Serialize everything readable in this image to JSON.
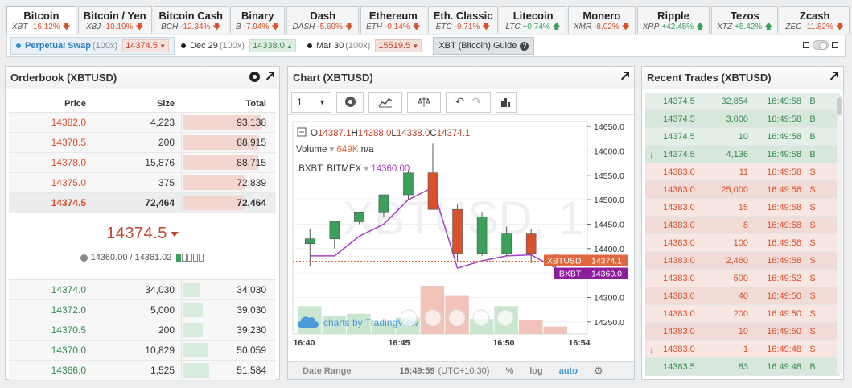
{
  "tabs": [
    {
      "name": "Bitcoin",
      "sym": "XBT",
      "change": "-16.12%",
      "dir": "neg",
      "active": true
    },
    {
      "name": "Bitcoin / Yen",
      "sym": "XBJ",
      "change": "-10.19%",
      "dir": "neg"
    },
    {
      "name": "Bitcoin Cash",
      "sym": "BCH",
      "change": "-12.34%",
      "dir": "neg"
    },
    {
      "name": "Binary",
      "sym": "B",
      "change": "-7.94%",
      "dir": "neg"
    },
    {
      "name": "Dash",
      "sym": "DASH",
      "change": "-5.69%",
      "dir": "neg"
    },
    {
      "name": "Ethereum",
      "sym": "ETH",
      "change": "-0.14%",
      "dir": "neg"
    },
    {
      "name": "Eth. Classic",
      "sym": "ETC",
      "change": "-9.71%",
      "dir": "neg"
    },
    {
      "name": "Litecoin",
      "sym": "LTC",
      "change": "+0.74%",
      "dir": "pos"
    },
    {
      "name": "Monero",
      "sym": "XMR",
      "change": "-8.02%",
      "dir": "neg"
    },
    {
      "name": "Ripple",
      "sym": "XRP",
      "change": "+42.45%",
      "dir": "pos"
    },
    {
      "name": "Tezos",
      "sym": "XTZ",
      "change": "+5.42%",
      "dir": "pos"
    },
    {
      "name": "Zcash",
      "sym": "ZEC",
      "change": "-11.82%",
      "dir": "neg"
    }
  ],
  "contracts": [
    {
      "label": "Perpetual Swap",
      "mult": "(100x)",
      "price": "14374.5",
      "dir": "neg",
      "active": true
    },
    {
      "label": "Dec 29",
      "mult": "(100x)",
      "price": "14338.0",
      "dir": "pos"
    },
    {
      "label": "Mar 30",
      "mult": "(100x)",
      "price": "15519.5",
      "dir": "neg"
    }
  ],
  "guide_label": "XBT (Bitcoin) Guide",
  "guide_icon": "?",
  "orderbook": {
    "title": "Orderbook (XBTUSD)",
    "col_price": "Price",
    "col_size": "Size",
    "col_total": "Total",
    "asks": [
      {
        "price": "14382.0",
        "size": "4,223",
        "total": "93,138",
        "depth": 0.93
      },
      {
        "price": "14378.5",
        "size": "200",
        "total": "88,915",
        "depth": 0.89
      },
      {
        "price": "14378.0",
        "size": "15,876",
        "total": "88,715",
        "depth": 0.89
      },
      {
        "price": "14375.0",
        "size": "375",
        "total": "72,839",
        "depth": 0.73
      },
      {
        "price": "14374.5",
        "size": "72,464",
        "total": "72,464",
        "depth": 0.72
      }
    ],
    "last_price": "14374.5",
    "index_price": "14360.00",
    "mark_price": "14361.02",
    "bids": [
      {
        "price": "14374.0",
        "size": "34,030",
        "total": "34,030",
        "depth": 0.2
      },
      {
        "price": "14372.0",
        "size": "5,000",
        "total": "39,030",
        "depth": 0.23
      },
      {
        "price": "14370.5",
        "size": "200",
        "total": "39,230",
        "depth": 0.23
      },
      {
        "price": "14370.0",
        "size": "10,829",
        "total": "50,059",
        "depth": 0.3
      },
      {
        "price": "14366.0",
        "size": "1,525",
        "total": "51,584",
        "depth": 0.31
      }
    ]
  },
  "chart": {
    "title": "Chart (XBTUSD)",
    "interval": "1",
    "ohlc": {
      "o_label": "O",
      "o": "14387.1",
      "h_label": "H",
      "h": "14388.0",
      "l_label": "L",
      "l": "14338.0",
      "c_label": "C",
      "c": "14374.1"
    },
    "volume_label": "Volume",
    "volume_value": "649K",
    "volume_extra": "n/a",
    "index_label": ".BXBT, BITMEX",
    "index_value": "14360.00",
    "watermark": "XBTUSD, 1",
    "branding": "charts by TradingView",
    "last_tag_label": "XBTUSD",
    "last_tag_value": "14374.1",
    "index_tag_label": ".BXBT",
    "index_tag_value": "14360.0",
    "yticks": [
      "14650.0",
      "14600.0",
      "14550.0",
      "14500.0",
      "14450.0",
      "14400.0",
      "14350.0",
      "14300.0",
      "14250.0"
    ],
    "xticks": [
      "16:40",
      "16:45",
      "16:50",
      "16:54"
    ],
    "footer": {
      "date_range": "Date Range",
      "time": "16:49:59",
      "tz": "(UTC+10:30)",
      "pct": "%",
      "log": "log",
      "auto": "auto"
    }
  },
  "chart_data": {
    "type": "candlestick",
    "ylim": [
      14225,
      14660
    ],
    "x": [
      "16:40",
      "16:41",
      "16:42",
      "16:43",
      "16:44",
      "16:45",
      "16:46",
      "16:47",
      "16:48",
      "16:49",
      "16:50"
    ],
    "candles": [
      {
        "o": 14410,
        "h": 14440,
        "l": 14365,
        "c": 14420
      },
      {
        "o": 14420,
        "h": 14445,
        "l": 14400,
        "c": 14455
      },
      {
        "o": 14455,
        "h": 14475,
        "l": 14450,
        "c": 14475
      },
      {
        "o": 14475,
        "h": 14500,
        "l": 14465,
        "c": 14510
      },
      {
        "o": 14510,
        "h": 14560,
        "l": 14500,
        "c": 14555
      },
      {
        "o": 14555,
        "h": 14615,
        "l": 14480,
        "c": 14480
      },
      {
        "o": 14480,
        "h": 14490,
        "l": 14375,
        "c": 14390
      },
      {
        "o": 14390,
        "h": 14475,
        "l": 14385,
        "c": 14465
      },
      {
        "o": 14390,
        "h": 14445,
        "l": 14385,
        "c": 14430
      },
      {
        "o": 14430,
        "h": 14440,
        "l": 14370,
        "c": 14390
      },
      {
        "o": 14387,
        "h": 14388,
        "l": 14338,
        "c": 14374
      }
    ],
    "index_line": [
      14385,
      14385,
      14425,
      14450,
      14500,
      14525,
      14360,
      14375,
      14385,
      14387,
      14360
    ],
    "volumes": [
      2.2,
      1.4,
      1.6,
      0.9,
      1.3,
      3.8,
      3.0,
      1.2,
      2.2,
      1.1,
      0.6
    ]
  },
  "trades": {
    "title": "Recent Trades (XBTUSD)",
    "rows": [
      {
        "price": "14374.5",
        "size": "32,854",
        "time": "16:49:58",
        "side": "B",
        "dir": "buy",
        "icon": ""
      },
      {
        "price": "14374.5",
        "size": "3,000",
        "time": "16:49:58",
        "side": "B",
        "dir": "buy",
        "icon": ""
      },
      {
        "price": "14374.5",
        "size": "10",
        "time": "16:49:58",
        "side": "B",
        "dir": "buy",
        "icon": ""
      },
      {
        "price": "14374.5",
        "size": "4,136",
        "time": "16:49:58",
        "side": "B",
        "dir": "buy",
        "icon": "↓"
      },
      {
        "price": "14383.0",
        "size": "11",
        "time": "16:49:58",
        "side": "S",
        "dir": "sell",
        "icon": ""
      },
      {
        "price": "14383.0",
        "size": "25,000",
        "time": "16:49:58",
        "side": "S",
        "dir": "sell",
        "icon": ""
      },
      {
        "price": "14383.0",
        "size": "15",
        "time": "16:49:58",
        "side": "S",
        "dir": "sell",
        "icon": ""
      },
      {
        "price": "14383.0",
        "size": "8",
        "time": "16:49:58",
        "side": "S",
        "dir": "sell",
        "icon": ""
      },
      {
        "price": "14383.0",
        "size": "100",
        "time": "16:49:58",
        "side": "S",
        "dir": "sell",
        "icon": ""
      },
      {
        "price": "14383.0",
        "size": "2,460",
        "time": "16:49:58",
        "side": "S",
        "dir": "sell",
        "icon": ""
      },
      {
        "price": "14383.0",
        "size": "500",
        "time": "16:49:52",
        "side": "S",
        "dir": "sell",
        "icon": ""
      },
      {
        "price": "14383.0",
        "size": "40",
        "time": "16:49:50",
        "side": "S",
        "dir": "sell",
        "icon": ""
      },
      {
        "price": "14383.0",
        "size": "200",
        "time": "16:49:50",
        "side": "S",
        "dir": "sell",
        "icon": ""
      },
      {
        "price": "14383.0",
        "size": "10",
        "time": "16:49:50",
        "side": "S",
        "dir": "sell",
        "icon": ""
      },
      {
        "price": "14383.0",
        "size": "1",
        "time": "16:49:48",
        "side": "S",
        "dir": "sell",
        "icon": "↓"
      },
      {
        "price": "14383.5",
        "size": "83",
        "time": "16:49:48",
        "side": "B",
        "dir": "buy",
        "icon": ""
      }
    ]
  },
  "colors": {
    "up": "#3aa05a",
    "down": "#d9502c",
    "index_line": "#a23fc0",
    "index_tag": "#8e1d9e",
    "last_tag": "#e0683f"
  }
}
